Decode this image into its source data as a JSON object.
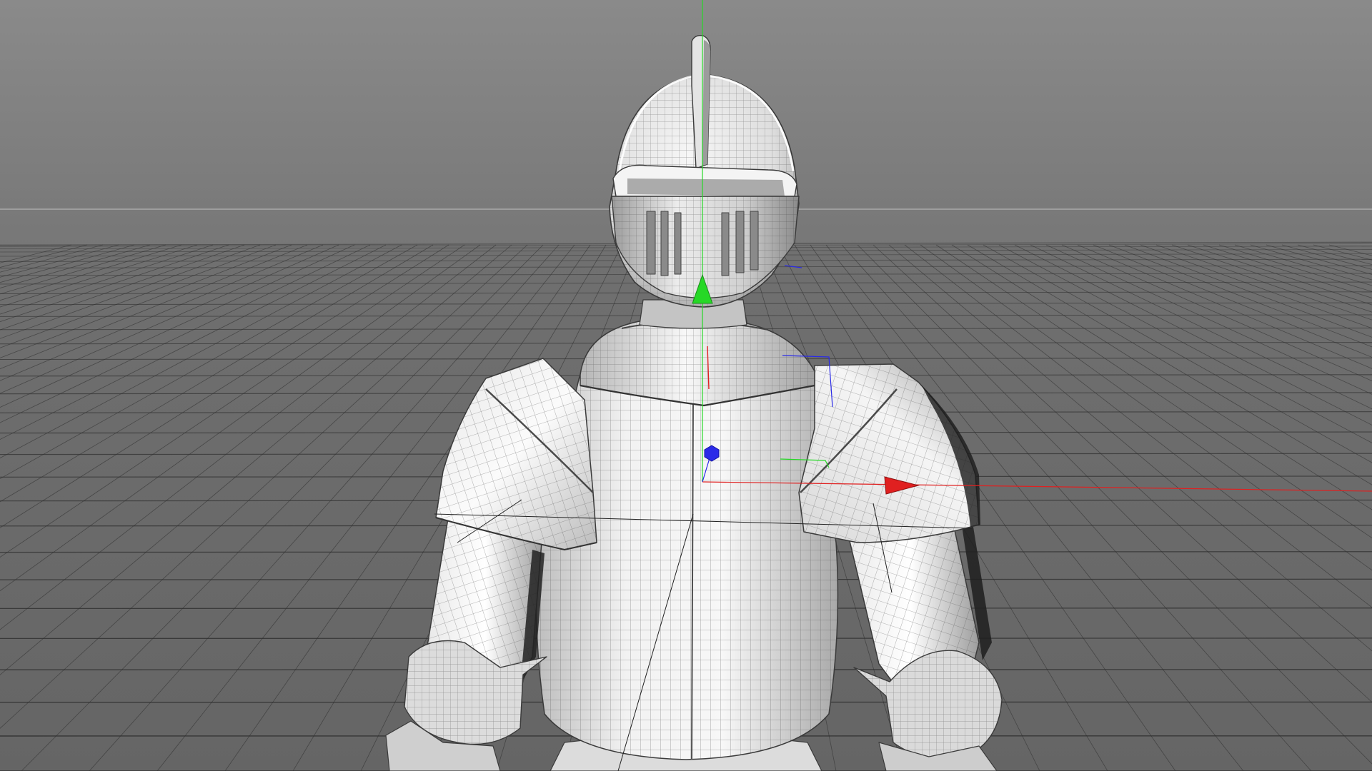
{
  "viewport": {
    "view": "perspective",
    "shading": "gouraud-shading-with-wireframe",
    "grid": "on",
    "horizon": "visible"
  },
  "scene": {
    "object": "knight-armor-model",
    "parts": [
      "helmet",
      "helmet-crest",
      "visor",
      "gorget",
      "breastplate",
      "left-pauldron",
      "right-pauldron",
      "left-arm",
      "right-arm",
      "left-gauntlet-cuff",
      "right-gauntlet-cuff"
    ]
  },
  "gizmo": {
    "type": "move-tool-axes",
    "axes": [
      "x-axis",
      "y-axis",
      "z-axis"
    ],
    "colors": {
      "x": "#e02020",
      "y": "#26d826",
      "z": "#2a2ae8"
    }
  },
  "colors": {
    "background_top": "#8a8a8a",
    "background_horizon": "#777777",
    "floor": "#6a6a6a",
    "grid_line": "#2e2e2e",
    "horizon_line": "#b2b2b2",
    "armor_highlight": "#f6f6f6",
    "armor_shadow": "#8e8e8e",
    "wire": "#404040"
  }
}
